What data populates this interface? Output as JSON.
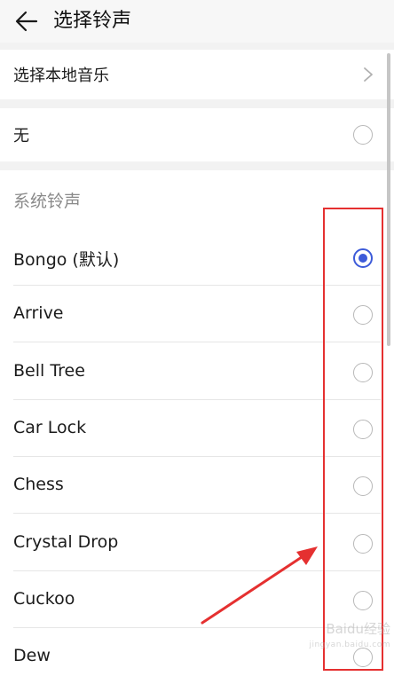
{
  "header": {
    "title": "选择铃声"
  },
  "local_music": {
    "label": "选择本地音乐"
  },
  "none_option": {
    "label": "无",
    "selected": false
  },
  "system_section": {
    "label": "系统铃声"
  },
  "ringtones": [
    {
      "label": "Bongo (默认)",
      "selected": true
    },
    {
      "label": "Arrive",
      "selected": false
    },
    {
      "label": "Bell Tree",
      "selected": false
    },
    {
      "label": "Car Lock",
      "selected": false
    },
    {
      "label": "Chess",
      "selected": false
    },
    {
      "label": "Crystal Drop",
      "selected": false
    },
    {
      "label": "Cuckoo",
      "selected": false
    },
    {
      "label": "Dew",
      "selected": false
    }
  ],
  "watermark": {
    "brand": "Baidu经验",
    "url": "jingyan.baidu.com"
  },
  "colors": {
    "accent": "#3d5bd9",
    "annotation": "#e53030"
  }
}
